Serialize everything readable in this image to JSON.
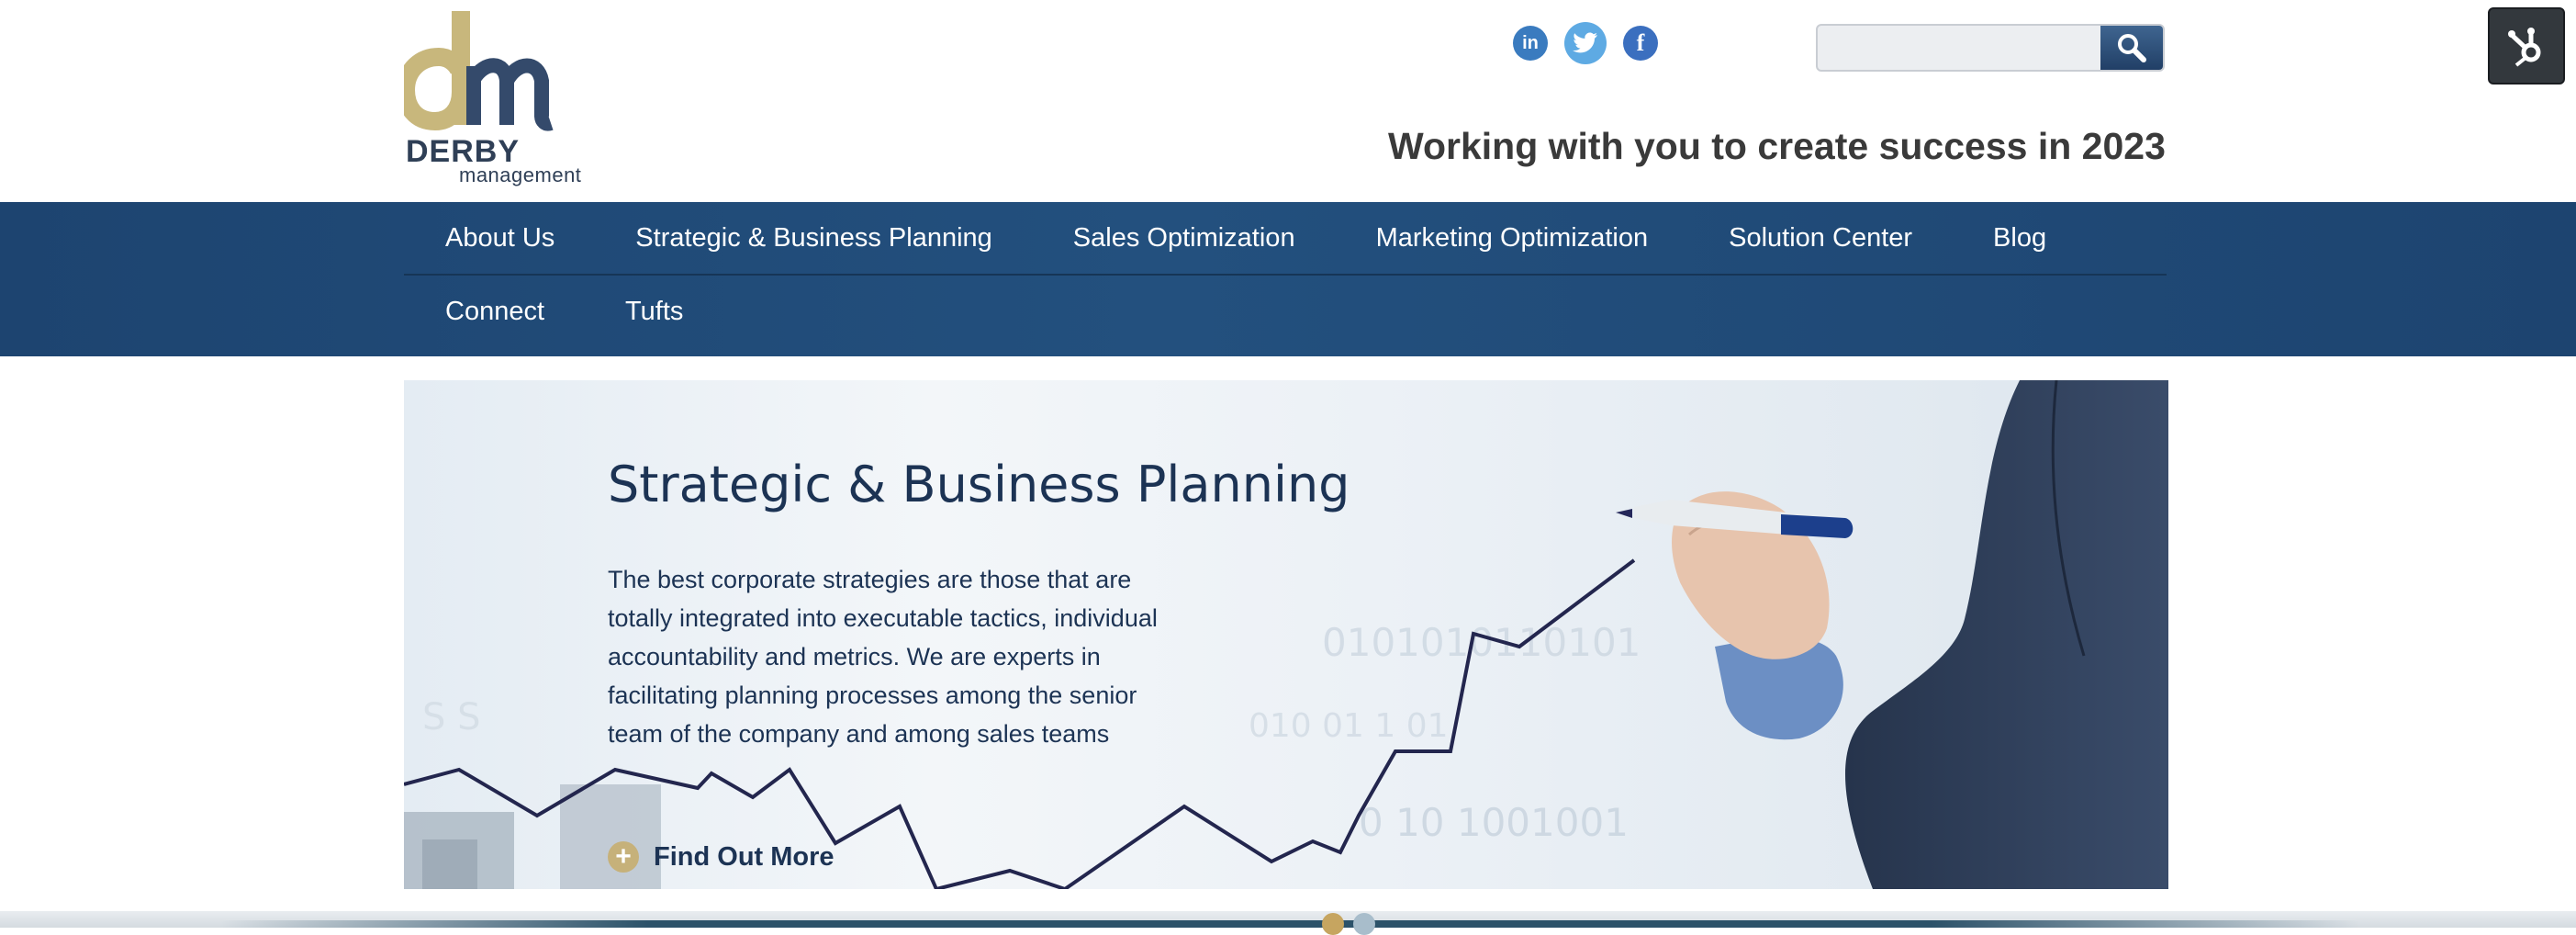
{
  "brand": {
    "name": "DERBY",
    "subname": "management",
    "monogram": "dm"
  },
  "header": {
    "tagline": "Working with you to create success in 2023",
    "social": [
      {
        "name": "linkedin",
        "icon": "linkedin-icon",
        "label": "in"
      },
      {
        "name": "twitter",
        "icon": "twitter-bird-icon"
      },
      {
        "name": "facebook",
        "icon": "facebook-icon",
        "label": "f"
      }
    ],
    "search": {
      "placeholder": "",
      "value": "",
      "icon": "magnifier-icon"
    }
  },
  "nav": {
    "row1": [
      "About Us",
      "Strategic & Business Planning",
      "Sales Optimization",
      "Marketing Optimization",
      "Solution Center",
      "Blog"
    ],
    "row2": [
      "Connect",
      "Tufts"
    ]
  },
  "hero": {
    "title": "Strategic & Business Planning",
    "body": "The best corporate strategies are those that are totally integrated into executable tactics, individual accountability and metrics.  We are experts in facilitating planning processes among the senior team of the company and among sales teams",
    "cta_label": "Find Out More",
    "cta_icon": "plus-circle-icon"
  },
  "slider": {
    "slides": 2,
    "active": 1
  },
  "colors": {
    "nav": "#1d4470",
    "accent_gold": "#c6b17a",
    "text_dark": "#1c3354",
    "hubspot": "#33383d"
  }
}
